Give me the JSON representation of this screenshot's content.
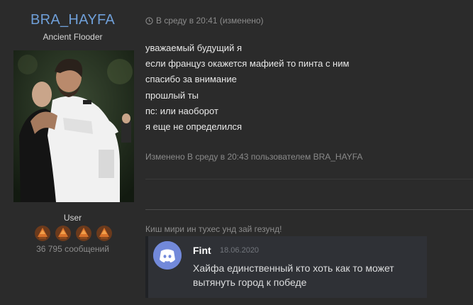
{
  "user": {
    "username": "BRA_HAYFA",
    "title": "Ancient Flooder",
    "group": "User",
    "message_count": "36 795 сообщений",
    "badges": [
      "trophy-icon",
      "trophy-icon",
      "trophy-icon",
      "trophy-icon"
    ]
  },
  "post": {
    "timestamp": "В среду в 20:41 (изменено)",
    "lines": [
      "уважаемый будущий я",
      "если француз окажется мафией то пинта с ним",
      "спасибо за внимание",
      "прошлый ты",
      "пс: или наоборот",
      "я еще не определился"
    ],
    "edited_note": "Изменено В среду в 20:43 пользователем BRA_HAYFA"
  },
  "signature": {
    "text": "Киш мири ин тухес унд зай гезунд!",
    "discord": {
      "name": "Fint",
      "date": "18.06.2020",
      "message": "Хайфа единственный кто хоть как то может вытянуть город к победе"
    }
  },
  "colors": {
    "background": "#2b2b2b",
    "username": "#6f9fd8",
    "discord_card": "#2f3136",
    "discord_blurple": "#7289da"
  }
}
